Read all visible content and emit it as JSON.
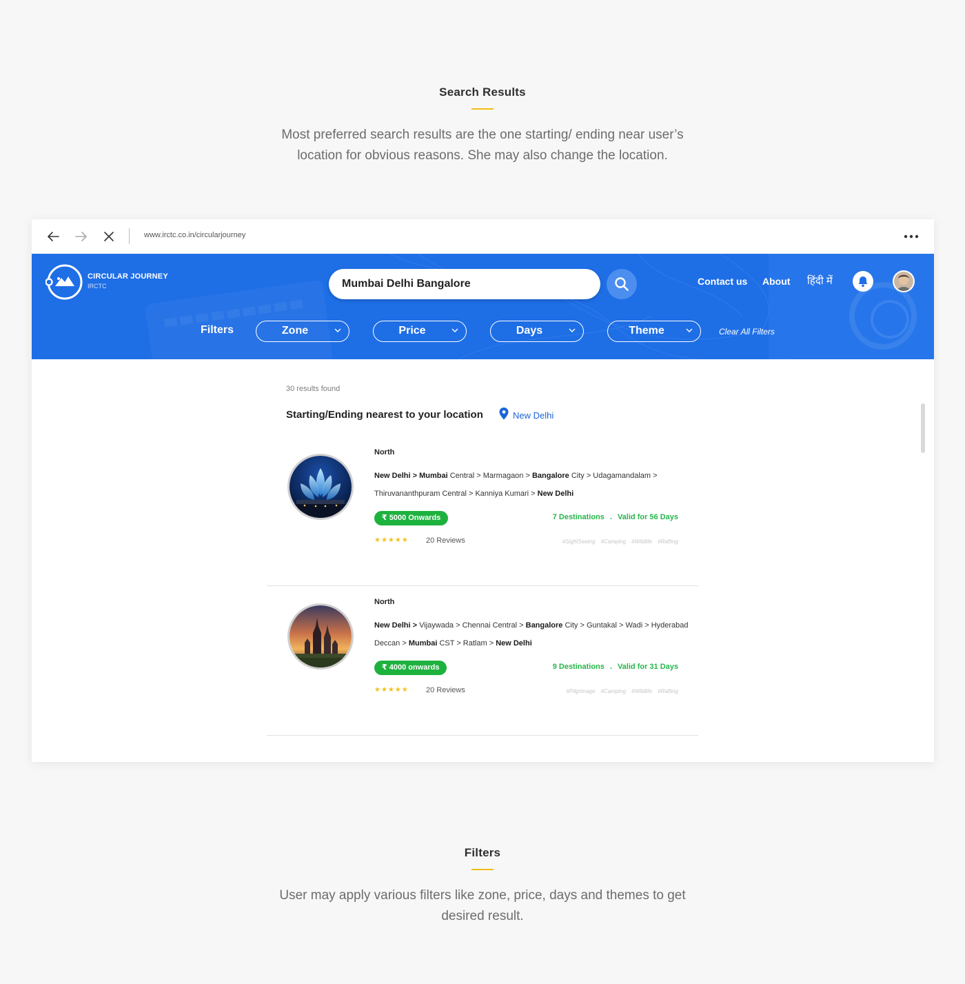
{
  "section1": {
    "title": "Search Results",
    "desc": "Most preferred search results are the one starting/ ending near user’s location for obvious reasons. She may also change the location."
  },
  "section2": {
    "title": "Filters",
    "desc": "User may apply various filters like zone, price, days and themes to get desired result."
  },
  "browser": {
    "url": "www.irctc.co.in/circularjourney",
    "icons": [
      "back-arrow-icon",
      "forward-arrow-icon",
      "close-icon",
      "more-icon"
    ]
  },
  "header": {
    "logo_title": "CIRCULAR JOURNEY",
    "logo_sub": "IRCTC",
    "search_value": "Mumbai Delhi Bangalore",
    "nav": [
      "Contact us",
      "About",
      "हिंदी में"
    ],
    "accent": "#1e6ee6"
  },
  "filters": {
    "label": "Filters",
    "pills": [
      "Zone",
      "Price",
      "Days",
      "Theme"
    ],
    "clear": "Clear All Filters"
  },
  "results": {
    "count": "30 results found",
    "location_title": "Starting/Ending nearest to your location",
    "location": "New Delhi",
    "cards": [
      {
        "zone": "North",
        "route": [
          {
            "t": "New Delhi > ",
            "b": true
          },
          {
            "t": "Mumbai",
            "b": true
          },
          {
            "t": " Central > Marmagaon > ",
            "b": false
          },
          {
            "t": "Bangalore",
            "b": true
          },
          {
            "t": " City > Udagamandalam > Thiruvananthpuram Central > Kanniya Kumari > ",
            "b": false
          },
          {
            "t": "New Delhi",
            "b": true
          }
        ],
        "price": "₹ 5000 Onwards",
        "destinations": "7 Destinations",
        "dot": ".",
        "validity": "Valid for 56 Days",
        "rating": 5,
        "stars": "★★★★★",
        "reviews": "20 Reviews",
        "tags": [
          "#SightSeeing",
          "#Camping",
          "#Wildlife",
          "#Rafting"
        ],
        "image": "lotus-temple-night"
      },
      {
        "zone": "North",
        "route": [
          {
            "t": "New Delhi > ",
            "b": true
          },
          {
            "t": "Vijaywada > Chennai Central > ",
            "b": false
          },
          {
            "t": "Bangalore",
            "b": true
          },
          {
            "t": " City > Guntakal > Wadi > Hyderabad Deccan > ",
            "b": false
          },
          {
            "t": "Mumbai",
            "b": true
          },
          {
            "t": " CST > Ratlam > ",
            "b": false
          },
          {
            "t": "New Delhi",
            "b": true
          }
        ],
        "price": "₹ 4000 onwards",
        "destinations": "9 Destinations",
        "dot": ".",
        "validity": "Valid for 31 Days",
        "rating": 5,
        "stars": "★★★★★",
        "reviews": "20 Reviews",
        "tags": [
          "#Pilgrimage",
          "#Camping",
          "#Wildlife",
          "#Rafting"
        ],
        "image": "temple-sunset"
      }
    ]
  },
  "colors": {
    "price_badge": "#1db23e",
    "meta_green": "#26b54a",
    "star": "#f4c01e",
    "location_link": "#1b64d8",
    "underline": "#f2bd11"
  }
}
